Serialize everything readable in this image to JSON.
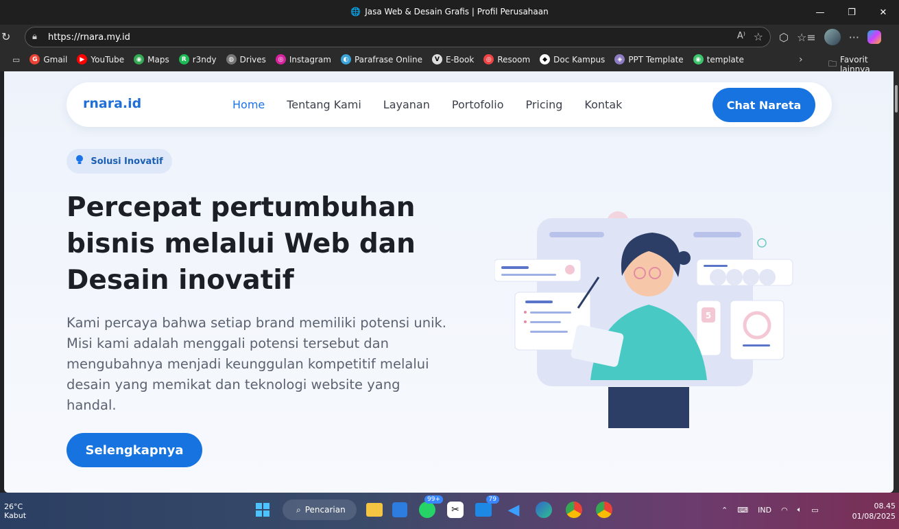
{
  "window": {
    "title": "Jasa Web & Desain Grafis | Profil Perusahaan"
  },
  "addressbar": {
    "url": "https://rnara.my.id"
  },
  "bookmarks": [
    {
      "label": "Gmail",
      "color": "#ea4335",
      "glyph": "G"
    },
    {
      "label": "YouTube",
      "color": "#ff0000",
      "glyph": "▶"
    },
    {
      "label": "Maps",
      "color": "#34a853",
      "glyph": "◉"
    },
    {
      "label": "r3ndy",
      "color": "#1db954",
      "glyph": "R"
    },
    {
      "label": "Drives",
      "color": "#777777",
      "glyph": "◍"
    },
    {
      "label": "Instagram",
      "color": "#d6249f",
      "glyph": "◎"
    },
    {
      "label": "Parafrase Online",
      "color": "#3aa3d8",
      "glyph": "◐"
    },
    {
      "label": "E-Book",
      "color": "#dddddd",
      "glyph": "V"
    },
    {
      "label": "Resoom",
      "color": "#e44",
      "glyph": "◎"
    },
    {
      "label": "Doc Kampus",
      "color": "#ffffff",
      "glyph": "◆"
    },
    {
      "label": "PPT Template",
      "color": "#8e7cc3",
      "glyph": "◈"
    },
    {
      "label": "template",
      "color": "#3ec46d",
      "glyph": "◉"
    }
  ],
  "bookmarks_other": "Favorit lainnya",
  "site": {
    "brand": "rnara.id",
    "nav": [
      "Home",
      "Tentang Kami",
      "Layanan",
      "Portofolio",
      "Pricing",
      "Kontak"
    ],
    "cta": "Chat Nareta",
    "pill": "Solusi Inovatif",
    "headline_1": "Percepat pertumbuhan",
    "headline_2": "bisnis melalui Web dan",
    "headline_3": "Desain inovatif",
    "lead": "Kami percaya bahwa setiap brand memiliki potensi unik. Misi kami adalah menggali potensi tersebut dan mengubahnya menjadi keunggulan kompetitif melalui desain yang memikat dan teknologi website yang handal.",
    "button": "Selengkapnya",
    "illus_card_number": "5"
  },
  "taskbar": {
    "temp": "26°C",
    "weather": "Kabut",
    "search": "Pencarian",
    "whatsapp_badge": "99+",
    "mail_badge": "79",
    "lang": "IND",
    "time": "08.45",
    "date": "01/08/2025"
  }
}
